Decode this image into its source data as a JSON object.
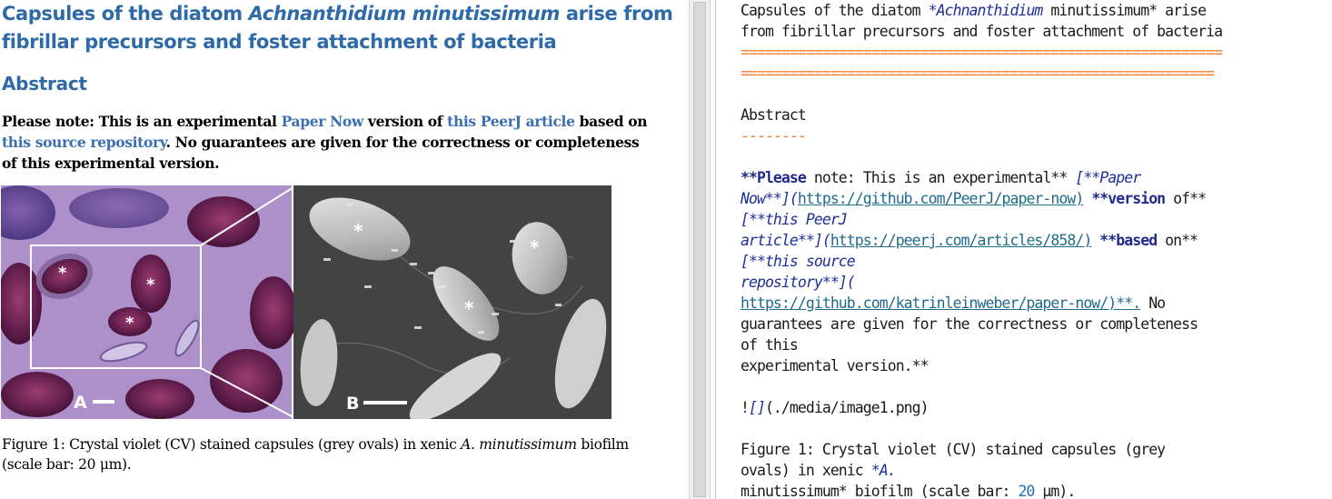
{
  "preview": {
    "title_line1_a": "Capsules of the diatom ",
    "title_line1_i": "Achnanthidium minutissimum",
    "title_line1_b": " arise from",
    "title_line2": "fibrillar precursors and foster attachment of bacteria",
    "abstract_heading": "Abstract",
    "note": {
      "t1": "Please note: This is an experimental ",
      "link1": "Paper Now",
      "t2": " version of ",
      "link2": "this PeerJ article",
      "t3": " based on",
      "link3": "this source repository",
      "t4": ". No guarantees are given for the correctness or completeness",
      "t5": "of this experimental version."
    },
    "figure": {
      "panel_a_label": "A",
      "panel_b_label": "B",
      "asterisk": "*"
    },
    "caption": {
      "t1": "Figure 1: Crystal violet (CV) stained capsules (grey ovals) in xenic ",
      "i1": "A. minutissimum",
      "t2": " biofilm",
      "t3": "(scale bar: 20 μm)."
    }
  },
  "source": {
    "l1a": "Capsules of the diatom ",
    "l1b": "*Achnanthidium",
    "l1c": " minutissimum* arise",
    "l2": "from fibrillar precursors and foster attachment of bacteria",
    "rule1": "===========================================================",
    "rule2": "==========================================================",
    "l5": "Abstract",
    "rule3": "--------",
    "p1a": "**Please",
    "p1b": " note: This is an experimental** ",
    "p1c": "[**Paper",
    "p2a": "Now**](",
    "p2b": "https://github.com/PeerJ/paper-now)",
    "p2c": " ",
    "p2d": "**version",
    "p2e": " of**",
    "p3": "[**this PeerJ",
    "p4a": "article**](",
    "p4b": "https://peerj.com/articles/858/)",
    "p4c": " ",
    "p4d": "**based",
    "p4e": " on**",
    "p5": "[**this source",
    "p6": "repository**](",
    "p7a": "https://github.com/katrinleinweber/paper-now/)",
    "p7b": "**.",
    "p7c": " No",
    "p8": "guarantees are given for the correctness or completeness",
    "p9": "of this",
    "p10": "experimental version.**",
    "img1": "!",
    "img2": "[]",
    "img3": "(./media/image1.png)",
    "c1": "Figure 1: Crystal violet (CV) stained capsules (grey",
    "c2a": "ovals) in xenic ",
    "c2b": "*A.",
    "c3a": "minutissimum* biofilm (scale bar: ",
    "c3b": "20",
    "c3c": " μm)."
  },
  "colors": {
    "heading_blue": "#2e6aa8",
    "link_blue": "#3b6fb0",
    "rule_orange": "#f07b28",
    "md_emphasis": "#1f2f9a"
  }
}
